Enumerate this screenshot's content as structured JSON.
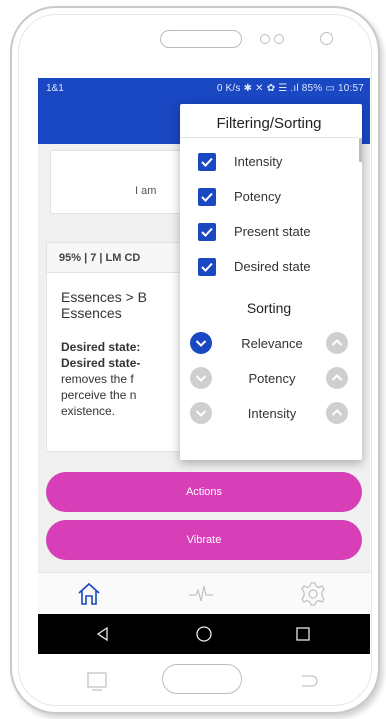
{
  "status_bar": {
    "carrier": "1&1",
    "indicators": "0 K/s ✱ ✕ ✿ ☰ .ıl 85% ▭ 10:57"
  },
  "card1": {
    "text": "I am"
  },
  "card2": {
    "header": "95% | 7 | LM CD",
    "breadcrumb": "Essences > B\nEssences",
    "body_line1": "Desired state:",
    "body_line2": "Desired state-",
    "body_line3": "removes the f",
    "body_line4": "perceive the n",
    "body_line5": "existence."
  },
  "buttons": {
    "actions": "Actions",
    "vibrate": "Vibrate"
  },
  "popup": {
    "title": "Filtering/Sorting",
    "filters": [
      {
        "label": "Intensity",
        "checked": true
      },
      {
        "label": "Potency",
        "checked": true
      },
      {
        "label": "Present state",
        "checked": true
      },
      {
        "label": "Desired state",
        "checked": true
      }
    ],
    "sorting_title": "Sorting",
    "sort_options": [
      {
        "label": "Relevance",
        "active": true
      },
      {
        "label": "Potency",
        "active": false
      },
      {
        "label": "Intensity",
        "active": false
      }
    ]
  },
  "icons": {
    "nav_home": "home-icon",
    "nav_pulse": "pulse-icon",
    "nav_settings": "gear-icon",
    "sys_back": "back-triangle-icon",
    "sys_home": "home-circle-icon",
    "sys_recent": "recent-square-icon"
  },
  "colors": {
    "primary_blue": "#1a47c2",
    "accent_pink": "#d63fb8",
    "inactive_grey": "#cfcfcf"
  }
}
